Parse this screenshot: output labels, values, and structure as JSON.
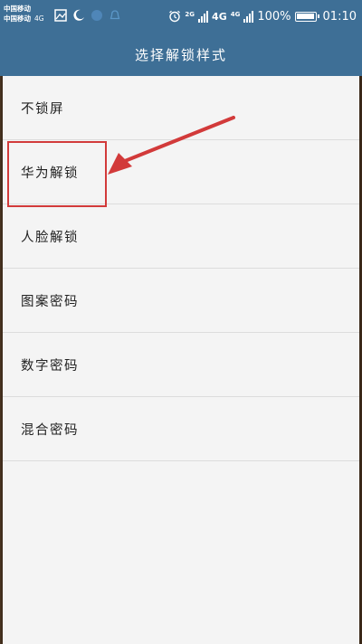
{
  "status_bar": {
    "carrier_1": "中国移动",
    "carrier_2": "中国移动",
    "carrier_2_network": "4G",
    "network_1": "4G",
    "network_1_sub": "2G",
    "network_2_sub": "4G",
    "battery": "100%",
    "time": "01:10",
    "icons": [
      "image-icon",
      "moon-icon",
      "bluetooth-icon",
      "bell-icon",
      "alarm-icon",
      "signal-icon",
      "battery-icon"
    ]
  },
  "header": {
    "title": "选择解锁样式"
  },
  "lock_options": [
    {
      "label": "不锁屏"
    },
    {
      "label": "华为解锁"
    },
    {
      "label": "人脸解锁"
    },
    {
      "label": "图案密码"
    },
    {
      "label": "数字密码"
    },
    {
      "label": "混合密码"
    }
  ],
  "annotation": {
    "highlighted_item": "华为解锁",
    "color": "#d23a3a"
  },
  "colors": {
    "header": "#3e6f96",
    "background": "#f4f4f4",
    "divider": "#dcdcdc",
    "text": "#222222"
  }
}
